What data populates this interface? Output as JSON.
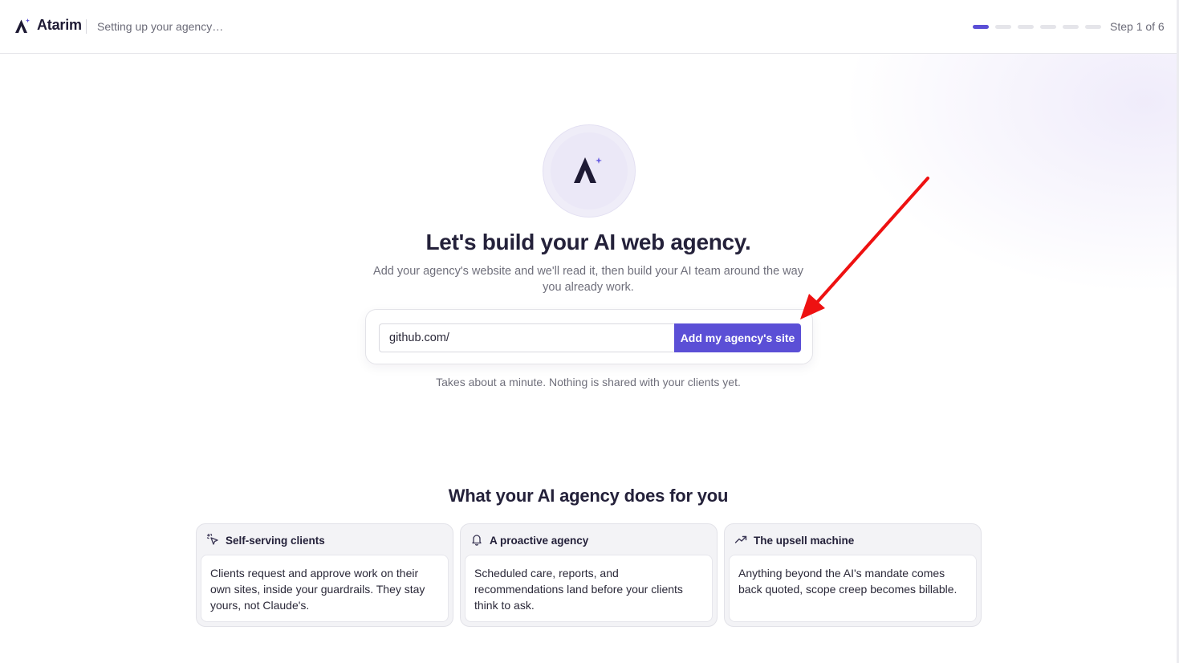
{
  "header": {
    "brand": "Atarim",
    "subtitle": "Setting up your agency…",
    "steps_total": 6,
    "steps_current": 1,
    "step_label": "Step 1 of 6"
  },
  "hero": {
    "logo_icon": "atarim-sparkle-logo",
    "title": "Let's build your AI web agency.",
    "subtitle": "Add your agency's website and we'll read it, then build your AI team around the way you already work.",
    "url_value": "github.com/",
    "button_label": "Add my agency's site",
    "hint": "Takes about a minute. Nothing is shared with your clients yet."
  },
  "features": {
    "title": "What your AI agency does for you",
    "cards": [
      {
        "icon": "sparkle-cursor-icon",
        "title": "Self-serving clients",
        "body": "Clients request and approve work on their own sites, inside your guardrails. They stay yours, not Claude's."
      },
      {
        "icon": "bell-icon",
        "title": "A proactive agency",
        "body": "Scheduled care, reports, and recommendations land before your clients think to ask."
      },
      {
        "icon": "trending-up-icon",
        "title": "The upsell machine",
        "body": "Anything beyond the AI's mandate comes back quoted, scope creep becomes billable."
      }
    ]
  },
  "colors": {
    "accent": "#5b4fd6",
    "brand_dark": "#1e1a34",
    "annotation": "#ee1111"
  }
}
